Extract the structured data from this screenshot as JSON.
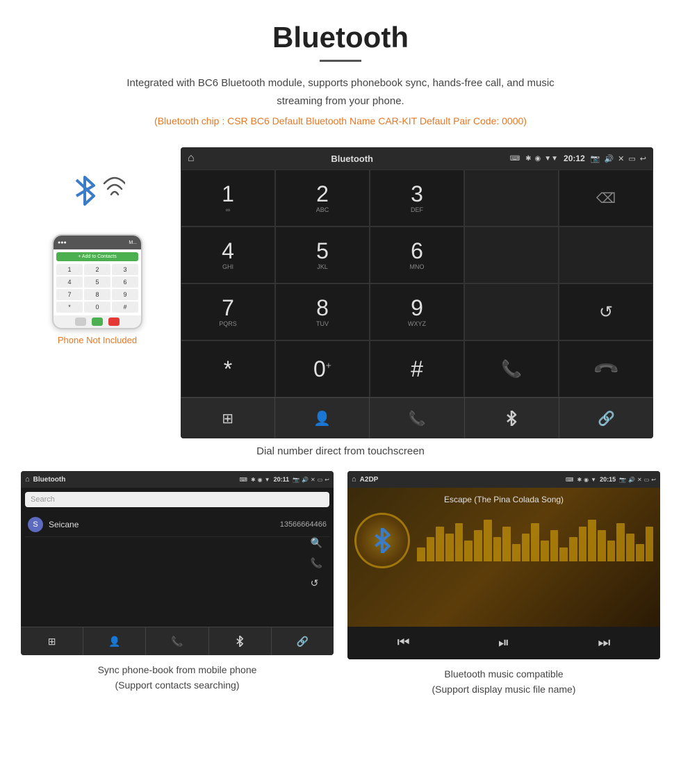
{
  "page": {
    "title": "Bluetooth",
    "underline": true,
    "description": "Integrated with BC6 Bluetooth module, supports phonebook sync, hands-free call, and music streaming from your phone.",
    "specs": "(Bluetooth chip : CSR BC6    Default Bluetooth Name CAR-KIT    Default Pair Code: 0000)"
  },
  "main_screen": {
    "status_bar": {
      "title": "Bluetooth",
      "usb_icon": "⌨",
      "time": "20:12",
      "icons": [
        "✱",
        "◉",
        "▼"
      ]
    },
    "dialpad": {
      "rows": [
        [
          {
            "num": "1",
            "letters": "∞"
          },
          {
            "num": "2",
            "letters": "ABC"
          },
          {
            "num": "3",
            "letters": "DEF"
          },
          {
            "num": "",
            "letters": ""
          },
          {
            "num": "⌫",
            "letters": ""
          }
        ],
        [
          {
            "num": "4",
            "letters": "GHI"
          },
          {
            "num": "5",
            "letters": "JKL"
          },
          {
            "num": "6",
            "letters": "MNO"
          },
          {
            "num": "",
            "letters": ""
          },
          {
            "num": "",
            "letters": ""
          }
        ],
        [
          {
            "num": "7",
            "letters": "PQRS"
          },
          {
            "num": "8",
            "letters": "TUV"
          },
          {
            "num": "9",
            "letters": "WXYZ"
          },
          {
            "num": "",
            "letters": ""
          },
          {
            "num": "↺",
            "letters": ""
          }
        ],
        [
          {
            "num": "*",
            "letters": ""
          },
          {
            "num": "0",
            "letters": "+"
          },
          {
            "num": "#",
            "letters": ""
          },
          {
            "num": "📞",
            "letters": "green"
          },
          {
            "num": "📞",
            "letters": "red"
          }
        ]
      ]
    },
    "toolbar": {
      "buttons": [
        "⊞",
        "👤",
        "📞",
        "✱",
        "🔗"
      ]
    },
    "caption": "Dial number direct from touchscreen"
  },
  "phone_illustration": {
    "label": "Phone Not Included"
  },
  "bottom_left": {
    "status": {
      "title": "Bluetooth",
      "time": "20:11"
    },
    "search_placeholder": "Search",
    "contacts": [
      {
        "letter": "S",
        "name": "Seicane",
        "phone": "13566664466"
      }
    ],
    "toolbar_icons": [
      "⊞",
      "👤",
      "📞",
      "✱",
      "🔗"
    ],
    "caption_line1": "Sync phone-book from mobile phone",
    "caption_line2": "(Support contacts searching)"
  },
  "bottom_right": {
    "status": {
      "title": "A2DP",
      "time": "20:15"
    },
    "song_title": "Escape (The Pina Colada Song)",
    "music_bars": [
      20,
      35,
      50,
      40,
      55,
      30,
      45,
      60,
      35,
      50,
      25,
      40,
      55,
      30,
      45,
      20,
      35,
      50,
      60,
      45,
      30,
      55,
      40,
      25,
      50
    ],
    "controls": [
      "⏮",
      "⏯",
      "⏭"
    ],
    "caption_line1": "Bluetooth music compatible",
    "caption_line2": "(Support display music file name)"
  }
}
